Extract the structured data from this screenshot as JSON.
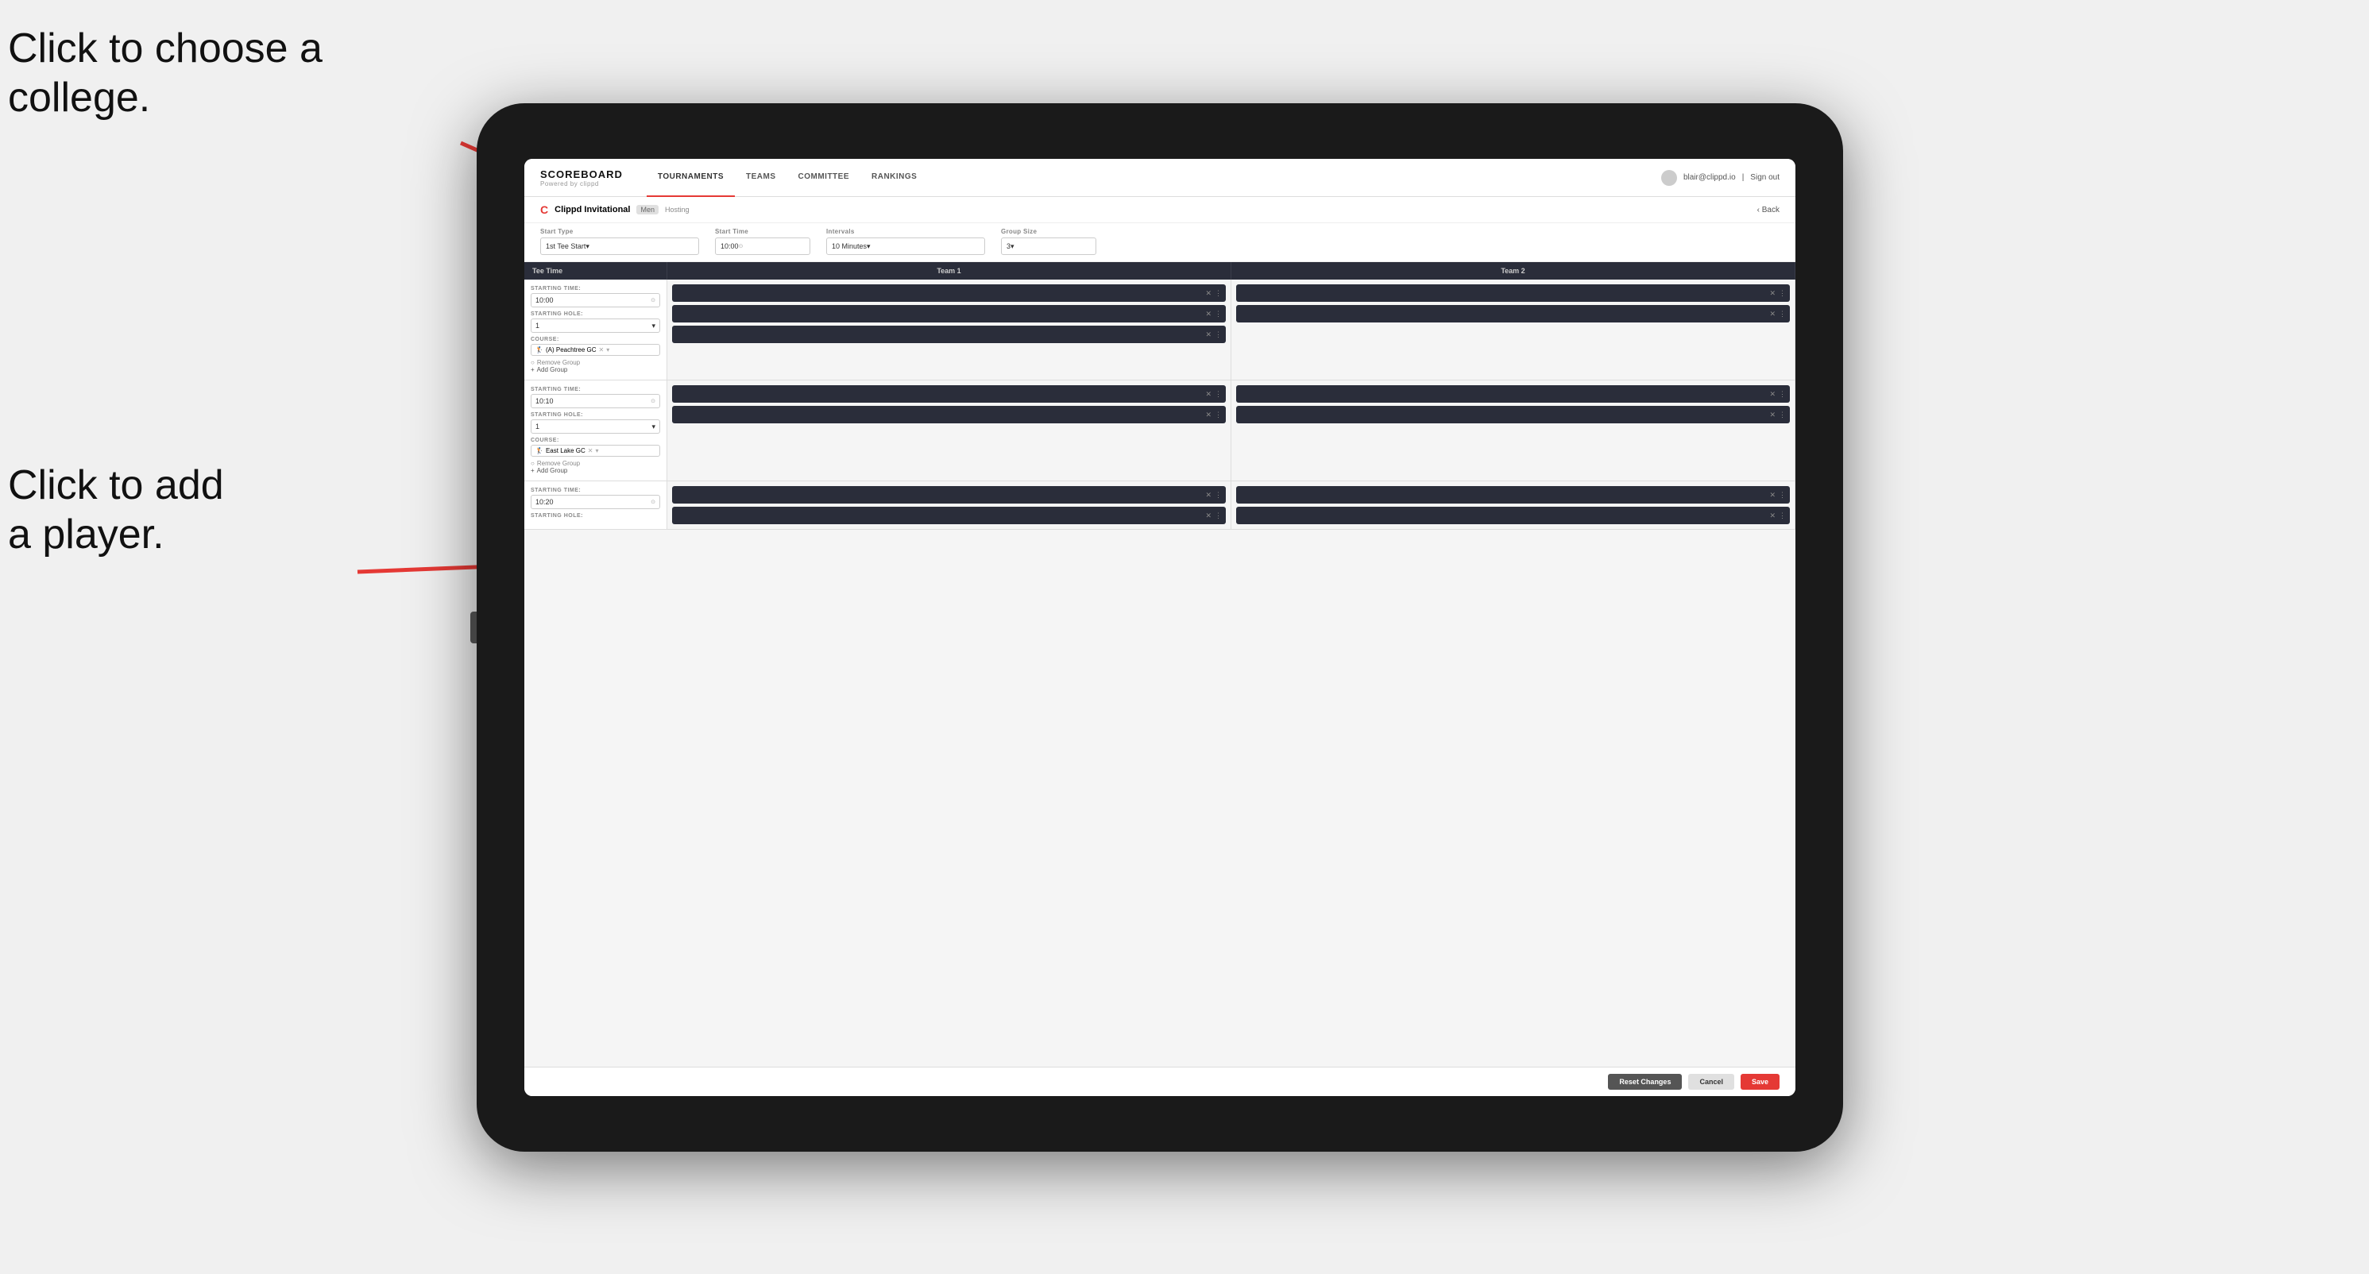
{
  "annotations": {
    "line1": "Click to choose a",
    "line2": "college.",
    "line3": "Click to add",
    "line4": "a player."
  },
  "nav": {
    "logo": "SCOREBOARD",
    "logo_sub": "Powered by clippd",
    "links": [
      "TOURNAMENTS",
      "TEAMS",
      "COMMITTEE",
      "RANKINGS"
    ],
    "active_link": "TOURNAMENTS",
    "user_email": "blair@clippd.io",
    "sign_out": "Sign out"
  },
  "sub_header": {
    "event_name": "Clippd Invitational",
    "gender": "Men",
    "status": "Hosting",
    "back": "Back"
  },
  "form": {
    "start_type_label": "Start Type",
    "start_type_value": "1st Tee Start",
    "start_time_label": "Start Time",
    "start_time_value": "10:00",
    "intervals_label": "Intervals",
    "intervals_value": "10 Minutes",
    "group_size_label": "Group Size",
    "group_size_value": "3"
  },
  "table": {
    "col1": "Tee Time",
    "col2": "Team 1",
    "col3": "Team 2"
  },
  "rows": [
    {
      "starting_time": "10:00",
      "starting_hole": "1",
      "course": "(A) Peachtree GC",
      "team1_slots": 3,
      "team2_slots": 2,
      "has_course": true,
      "course_icon": "🏌"
    },
    {
      "starting_time": "10:10",
      "starting_hole": "1",
      "course": "East Lake GC",
      "team1_slots": 2,
      "team2_slots": 2,
      "has_course": true,
      "course_icon": "🏌"
    },
    {
      "starting_time": "10:20",
      "starting_hole": "",
      "course": "",
      "team1_slots": 2,
      "team2_slots": 2,
      "has_course": false
    }
  ],
  "buttons": {
    "reset": "Reset Changes",
    "cancel": "Cancel",
    "save": "Save"
  }
}
